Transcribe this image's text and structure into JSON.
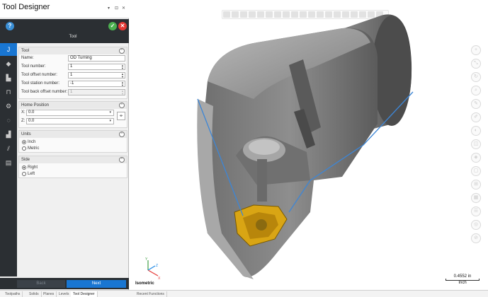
{
  "window": {
    "title": "Tool Designer",
    "controls": [
      "▾",
      "⊡",
      "✕"
    ]
  },
  "header": {
    "section": "Tool"
  },
  "rail": [
    "tool-j-icon",
    "insert-icon",
    "holder-icon",
    "assembly-icon",
    "settings-icon",
    "dashed-circle-icon",
    "machine-icon",
    "chart-icon",
    "report-icon"
  ],
  "tool_group": {
    "title": "Tool",
    "fields": [
      {
        "label": "Name:",
        "value": "OD Turning",
        "spin": false,
        "disabled": false
      },
      {
        "label": "Tool number:",
        "value": "1",
        "spin": true,
        "disabled": false
      },
      {
        "label": "Tool offset number:",
        "value": "1",
        "spin": true,
        "disabled": false
      },
      {
        "label": "Tool station number:",
        "value": "-1",
        "spin": true,
        "disabled": false
      },
      {
        "label": "Tool back offset number:",
        "value": "1",
        "spin": true,
        "disabled": true
      }
    ]
  },
  "home_group": {
    "title": "Home Position",
    "x_label": "X:",
    "x_value": "0.0",
    "z_label": "Z:",
    "z_value": "0.0"
  },
  "units_group": {
    "title": "Units",
    "options": [
      "Inch",
      "Metric"
    ],
    "selected": 0
  },
  "side_group": {
    "title": "Side",
    "options": [
      "Right",
      "Left"
    ],
    "selected": 0
  },
  "footer": {
    "back": "Back",
    "next": "Next"
  },
  "viewport": {
    "view_label": "Isometric",
    "scale_value": "0.4552 in",
    "scale_unit": "Inch",
    "triad": {
      "x": "X",
      "y": "Y",
      "z": "Z"
    }
  },
  "status_tabs": [
    "Toolpaths",
    "Solids",
    "Planes",
    "Levels",
    "Tool Designer",
    "Recent Functions"
  ],
  "active_status_tab": 4,
  "colors": {
    "accent": "#1976d2",
    "panel_dark": "#2b2f33",
    "insert_gold": "#d9a514",
    "edge_blue": "#3d86d6"
  }
}
